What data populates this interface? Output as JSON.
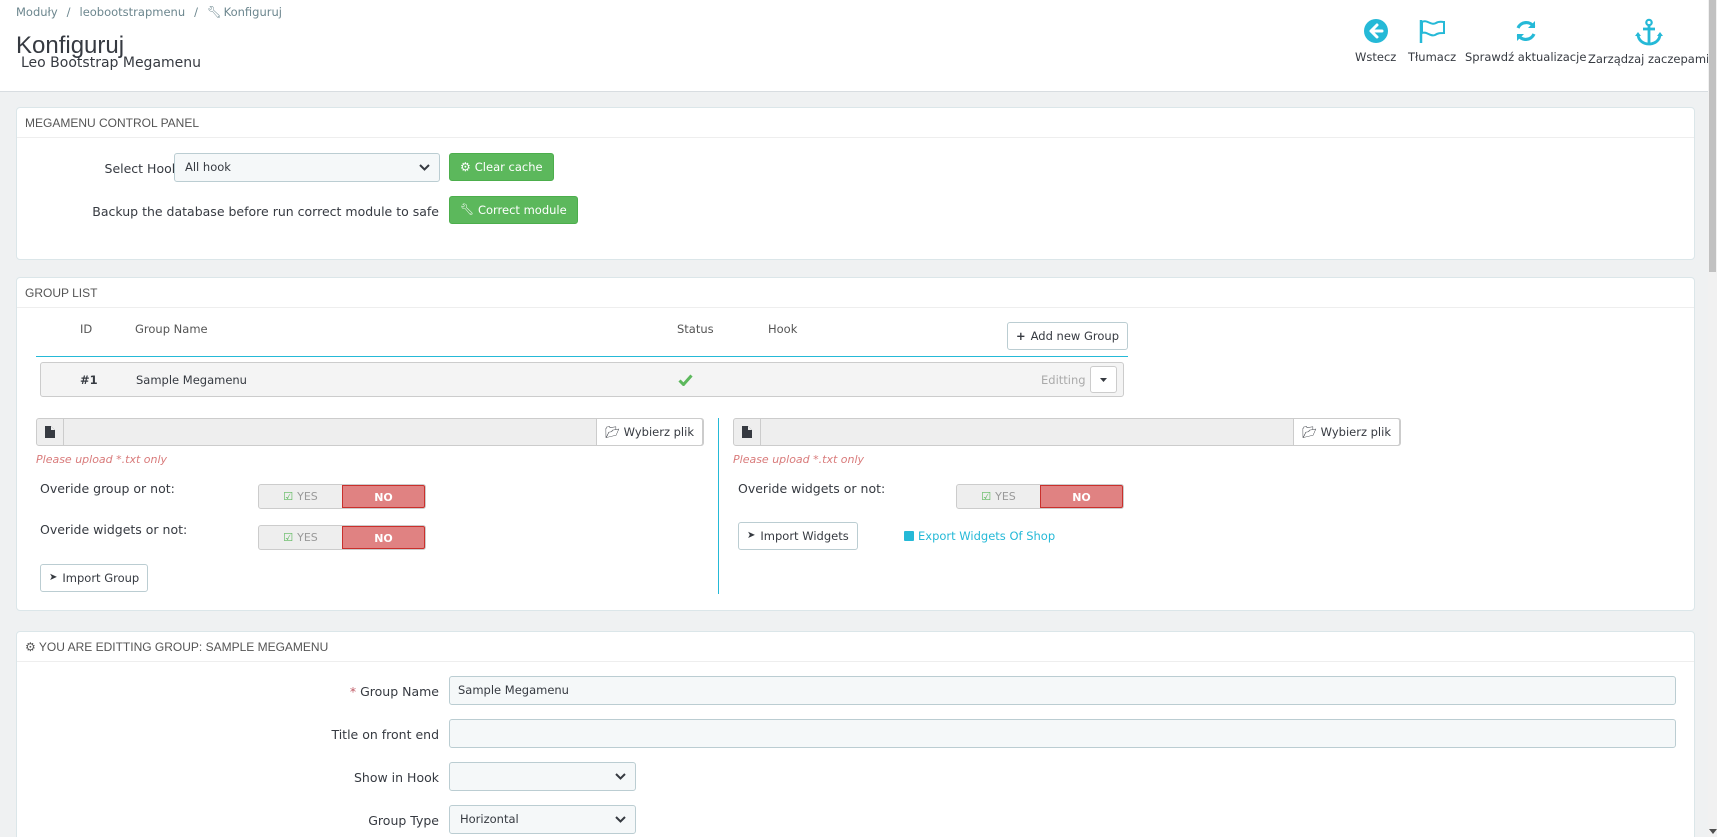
{
  "breadcrumb": {
    "items": [
      "Moduły",
      "leobootstrapmenu",
      "Konfiguruj"
    ]
  },
  "page": {
    "title": "Konfiguruj",
    "subtitle": "Leo Bootstrap Megamenu"
  },
  "toolbar": {
    "back_label": "Wstecz",
    "translate_label": "Tłumacz",
    "updates_label": "Sprawdź aktualizacje",
    "hooks_label": "Zarządzaj zaczepami"
  },
  "control_panel": {
    "heading": "MEGAMENU CONTROL PANEL",
    "select_hook_label": "Select Hook",
    "select_hook_value": "All hook",
    "clear_cache_label": "Clear cache",
    "backup_label": "Backup the database before run correct module to safe",
    "correct_module_label": "Correct module"
  },
  "group_list": {
    "heading": "GROUP LIST",
    "columns": {
      "id": "ID",
      "name": "Group Name",
      "status": "Status",
      "hook": "Hook"
    },
    "add_new_label": "Add new Group",
    "row": {
      "id": "#1",
      "name": "Sample Megamenu",
      "action": "Editting"
    },
    "left": {
      "browse_label": "Wybierz plik",
      "hint": "Please upload *.txt only",
      "override_group_label": "Overide group or not:",
      "override_widgets_label": "Overide widgets or not:",
      "yes_label": "YES",
      "no_label": "NO",
      "import_label": "Import Group"
    },
    "right": {
      "browse_label": "Wybierz plik",
      "hint": "Please upload *.txt only",
      "override_widgets_label": "Overide widgets or not:",
      "yes_label": "YES",
      "no_label": "NO",
      "import_label": "Import Widgets",
      "export_label": "Export Widgets Of Shop"
    }
  },
  "edit_group": {
    "heading": "YOU ARE EDITTING GROUP: SAMPLE MEGAMENU",
    "required_mark": "*",
    "group_name_label": "Group Name",
    "group_name_value": "Sample Megamenu",
    "title_label": "Title on front end",
    "title_value": "",
    "show_in_hook_label": "Show in Hook",
    "show_in_hook_value": "",
    "group_type_label": "Group Type",
    "group_type_value": "Horizontal"
  },
  "colors": {
    "accent": "#25b9d7",
    "success": "#5cb85c",
    "danger_soft": "#e08282",
    "hint": "#d97b7b"
  }
}
